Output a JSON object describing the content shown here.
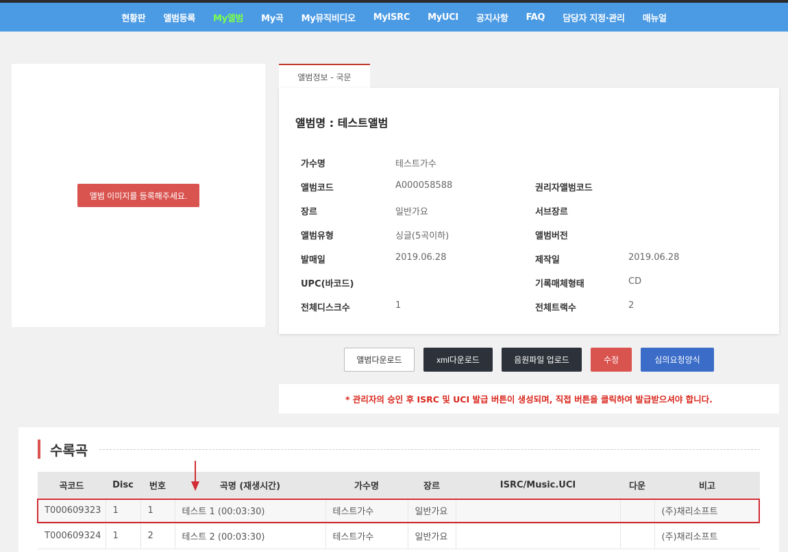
{
  "nav": {
    "items": [
      "현황판",
      "앨범등록",
      "My앨범",
      "My곡",
      "My뮤직비디오",
      "MyISRC",
      "MyUCI",
      "공지사항",
      "FAQ",
      "담당자 지정·관리",
      "매뉴얼"
    ],
    "active": "My앨범",
    "active_color": "#7cff4a"
  },
  "image_section": {
    "button_label": "앨범 이미지를 등록해주세요."
  },
  "tab_label": "앨범정보 - 국문",
  "album": {
    "title": "앨범명 : 테스트앨범",
    "fields": {
      "artist_label": "가수명",
      "artist": "테스트가수",
      "code_label": "앨범코드",
      "code": "A000058588",
      "rights_code_label": "권리자앨범코드",
      "rights_code": "",
      "genre_label": "장르",
      "genre": "일반가요",
      "subgenre_label": "서브장르",
      "subgenre": "",
      "type_label": "앨범유형",
      "type": "싱글(5곡이하)",
      "version_label": "앨범버전",
      "version": "",
      "release_label": "발매일",
      "release": "2019.06.28",
      "produced_label": "제작일",
      "produced": "2019.06.28",
      "upc_label": "UPC(바코드)",
      "upc": "",
      "media_label": "기록매체형태",
      "media": "CD",
      "discs_label": "전체디스크수",
      "discs": "1",
      "tracks_label": "전체트랙수",
      "tracks": "2"
    }
  },
  "buttons": {
    "download_album": "앨범다운로드",
    "download_xml": "xml다운로드",
    "upload_audio": "음원파일 업로드",
    "edit": "수정",
    "review_form": "심의요청양식"
  },
  "notice": "* 관리자의 승인 후 ISRC 및 UCI 발급 버튼이 생성되며, 직접 버튼을 클릭하여 발급받으셔야 합니다.",
  "tracks": {
    "title": "수록곡",
    "headers": [
      "곡코드",
      "Disc",
      "번호",
      "곡명 (재생시간)",
      "가수명",
      "장르",
      "ISRC/Music.UCI",
      "다운",
      "비고"
    ],
    "rows": [
      {
        "code": "T000609323",
        "disc": "1",
        "no": "1",
        "name": "테스트 1 (00:03:30)",
        "artist": "테스트가수",
        "genre": "일반가요",
        "isrc": "",
        "down": "",
        "note": "(주)채리소프트"
      },
      {
        "code": "T000609324",
        "disc": "1",
        "no": "2",
        "name": "테스트 2 (00:03:30)",
        "artist": "테스트가수",
        "genre": "일반가요",
        "isrc": "",
        "down": "",
        "note": "(주)채리소프트"
      }
    ]
  },
  "colors": {
    "nav_bg": "#4a9ae4",
    "accent_red": "#d9534f",
    "highlight_border": "#d12b33",
    "dark_button": "#2c313a",
    "blue_button": "#3a6cc8"
  }
}
